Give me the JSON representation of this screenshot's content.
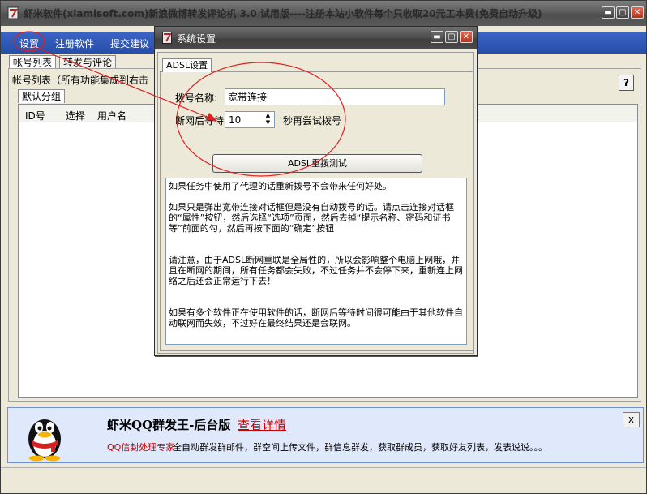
{
  "window": {
    "title": "虾米软件(xiamisoft.com)新浪微博转发评论机 3.0 试用版----注册本站小软件每个只收取20元工本费(免费自动升级)",
    "controls": {
      "minimize": "▬",
      "maximize": "▢",
      "close": "✕"
    }
  },
  "menu": {
    "items": [
      "设置",
      "注册软件",
      "提交建议"
    ]
  },
  "tabs": [
    "帐号列表",
    "转发与评论"
  ],
  "account_panel": {
    "group_title": "帐号列表（所有功能集成到右击",
    "help": "?",
    "subtab": "默认分组",
    "columns": [
      "ID号",
      "选择",
      "用户名"
    ]
  },
  "dialog": {
    "title": "系统设置",
    "controls": {
      "minimize": "▬",
      "maximize": "▢",
      "close": "✕"
    },
    "tab": "ADSL设置",
    "dial_name_label": "拨号名称:",
    "dial_name_value": "宽带连接",
    "retry_label_before": "断网后等待",
    "retry_value": "10",
    "retry_label_after": "秒再尝试拨号",
    "redial_button": "ADSL重拨测试",
    "note": "如果任务中使用了代理的话重新拨号不会带来任何好处。\n\n如果只是弹出宽带连接对话框但是没有自动拨号的话。请点击连接对话框的“属性”按钮，然后选择“选项”页面，然后去掉“提示名称、密码和证书等”前面的勾，然后再按下面的“确定”按钮\n\n\n请注意，由于ADSL断网重联是全局性的，所以会影响整个电脑上网哦，并且在断网的期间，所有任务都会失败，不过任务并不会停下来，重新连上网络之后还会正常运行下去！\n\n\n如果有多个软件正在使用软件的话，断网后等待时间很可能由于其他软件自动联网而失效，不过好在最终结果还是会联网。"
  },
  "ad": {
    "title": "虾米QQ群发王-后台版",
    "link": "查看详情",
    "red_text": "QQ信封处理专家",
    "description": "全自动群发群邮件，群空间上传文件，群信息群发，获取群成员，获取好友列表，发表说说。。。",
    "close": "x"
  },
  "colors": {
    "menubar": "#2f58b8",
    "ad_background": "#dfe9fb",
    "annotation": "#e02020",
    "close_button": "#c8401f"
  }
}
